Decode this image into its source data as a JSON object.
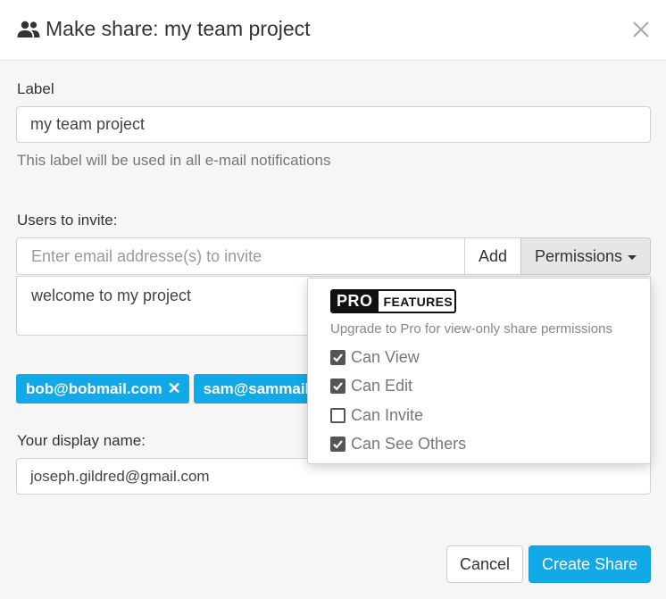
{
  "dialog": {
    "title": "Make share: my team project",
    "title_icon": "users-icon",
    "close_icon": "close-icon"
  },
  "label_field": {
    "heading": "Label",
    "value": "my team project",
    "help": "This label will be used in all e-mail notifications"
  },
  "invite": {
    "heading": "Users to invite:",
    "placeholder": "Enter email addresse(s) to invite",
    "add_label": "Add",
    "permissions_label": "Permissions",
    "message": "welcome to my project",
    "chips": [
      "bob@bobmail.com",
      "sam@sammail.com"
    ]
  },
  "permissions_dropdown": {
    "badge_pro": "PRO",
    "badge_features": "FEATURES",
    "upgrade_text": "Upgrade to Pro for view-only share permissions",
    "options": [
      {
        "label": "Can View",
        "checked": true
      },
      {
        "label": "Can Edit",
        "checked": true
      },
      {
        "label": "Can Invite",
        "checked": false
      },
      {
        "label": "Can See Others",
        "checked": true
      }
    ]
  },
  "display_name": {
    "heading": "Your display name:",
    "value": "joseph.gildred@gmail.com"
  },
  "footer": {
    "cancel_label": "Cancel",
    "create_label": "Create Share"
  },
  "colors": {
    "accent": "#12a9e8",
    "background": "#f6f6f6",
    "header": "#ffffff"
  }
}
